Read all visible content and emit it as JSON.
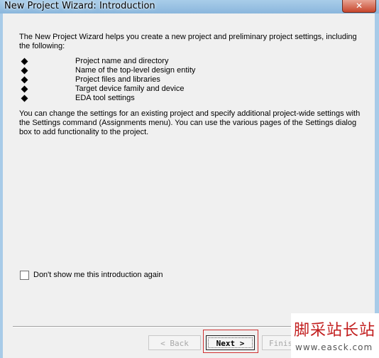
{
  "window": {
    "title": "New Project Wizard: Introduction",
    "close_glyph": "✕"
  },
  "intro_text": "The New Project Wizard helps you create a new project and preliminary project settings, including the following:",
  "bullet_items": [
    "Project name and directory",
    "Name of the top-level design entity",
    "Project files and libraries",
    "Target device family and device",
    "EDA tool settings"
  ],
  "settings_text": "You can change the settings for an existing project and specify additional project-wide settings with the Settings command (Assignments menu). You can use the various pages of the Settings dialog box to add functionality to the project.",
  "dont_show": {
    "label": "Don't show me this introduction again",
    "checked": false
  },
  "buttons": {
    "back": "< Back",
    "next": "Next >",
    "finish": "Finish"
  },
  "watermark": {
    "text": "脚采站长站",
    "url": "www.easck.com"
  },
  "colors": {
    "highlight": "#d03030",
    "titlebar": "#a9cde9"
  }
}
